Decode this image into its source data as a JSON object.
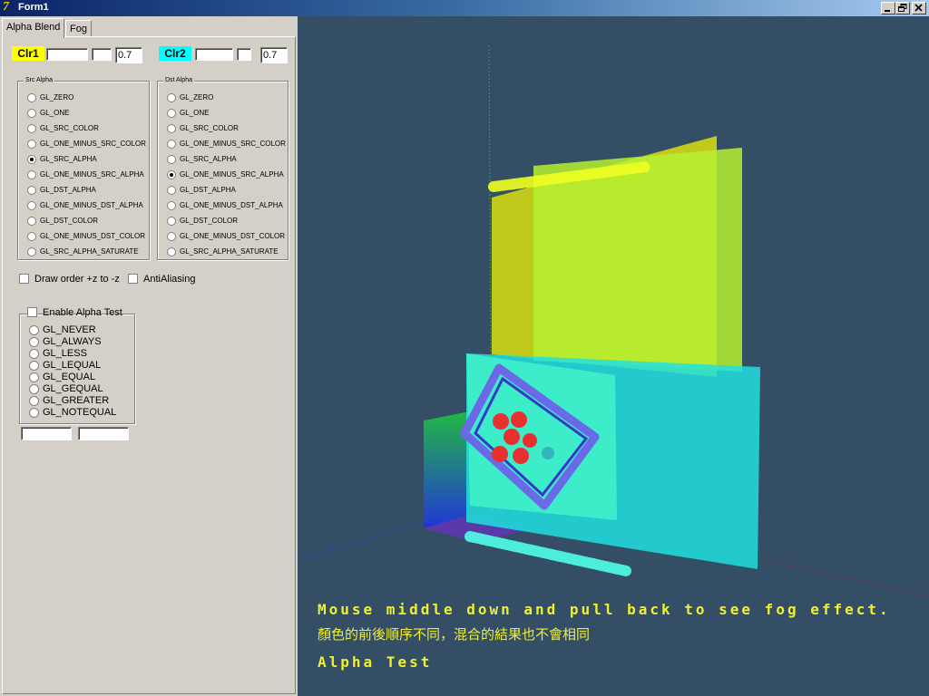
{
  "window": {
    "title": "Form1",
    "app_icon": "delphi-icon",
    "buttons": [
      "minimize-icon",
      "restore-icon",
      "close-icon"
    ]
  },
  "tabs": [
    {
      "label": "Alpha Blend",
      "active": true
    },
    {
      "label": "Fog",
      "active": false
    }
  ],
  "colors": {
    "clr1_label": "Clr1",
    "clr1_color": "#ffff00",
    "clr1_alpha": "0.7",
    "clr2_label": "Clr2",
    "clr2_color": "#00ffff",
    "clr2_alpha": "0.7"
  },
  "src_alpha": {
    "title": "Src Alpha",
    "options": [
      "GL_ZERO",
      "GL_ONE",
      "GL_SRC_COLOR",
      "GL_ONE_MINUS_SRC_COLOR",
      "GL_SRC_ALPHA",
      "GL_ONE_MINUS_SRC_ALPHA",
      "GL_DST_ALPHA",
      "GL_ONE_MINUS_DST_ALPHA",
      "GL_DST_COLOR",
      "GL_ONE_MINUS_DST_COLOR",
      "GL_SRC_ALPHA_SATURATE"
    ],
    "selected": "GL_SRC_ALPHA"
  },
  "dst_alpha": {
    "title": "Dst Alpha",
    "options": [
      "GL_ZERO",
      "GL_ONE",
      "GL_SRC_COLOR",
      "GL_ONE_MINUS_SRC_COLOR",
      "GL_SRC_ALPHA",
      "GL_ONE_MINUS_SRC_ALPHA",
      "GL_DST_ALPHA",
      "GL_ONE_MINUS_DST_ALPHA",
      "GL_DST_COLOR",
      "GL_ONE_MINUS_DST_COLOR",
      "GL_SRC_ALPHA_SATURATE"
    ],
    "selected": "GL_ONE_MINUS_SRC_ALPHA"
  },
  "options": {
    "draw_order_label": "Draw order +z to -z",
    "draw_order_checked": false,
    "antialiasing_label": "AntiAliasing",
    "antialiasing_checked": false
  },
  "alpha_test": {
    "enable_label": "Enable Alpha Test",
    "enabled": false,
    "functions": [
      "GL_NEVER",
      "GL_ALWAYS",
      "GL_LESS",
      "GL_LEQUAL",
      "GL_EQUAL",
      "GL_GEQUAL",
      "GL_GREATER",
      "GL_NOTEQUAL"
    ],
    "selected": null,
    "value1": "",
    "value2": ""
  },
  "viewport": {
    "background": "#344e66",
    "hint_text": "Mouse middle down and pull back to see fog effect.",
    "chinese_text": "顏色的前後順序不同，混合的結果也不會相同",
    "alpha_test_text": "Alpha Test"
  }
}
